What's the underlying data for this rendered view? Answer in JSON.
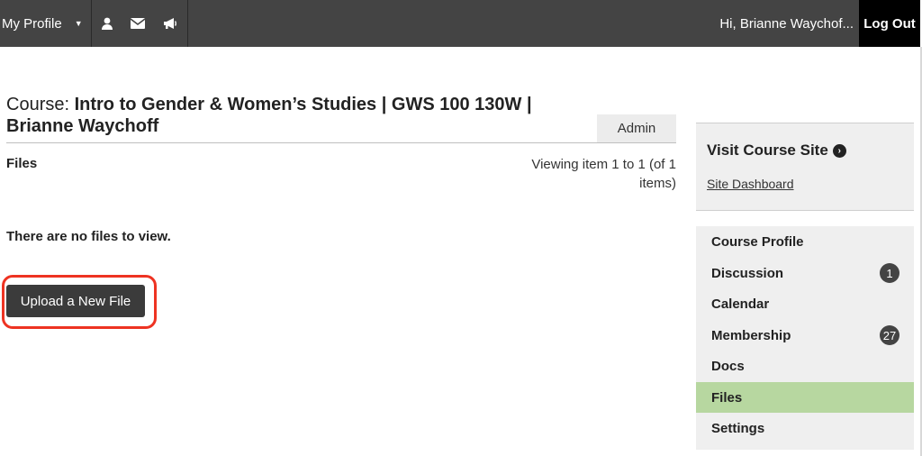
{
  "topbar": {
    "profile_label": "My Profile",
    "greeting": "Hi, Brianne Waychof...",
    "logout_label": "Log Out",
    "icons": [
      "user-icon",
      "envelope-icon",
      "megaphone-icon"
    ]
  },
  "course": {
    "prefix": "Course:",
    "name_line1": "Intro to Gender & Women’s Studies | GWS 100 130W |",
    "name_line2": "Brianne Waychoff",
    "admin_tab": "Admin"
  },
  "files": {
    "heading": "Files",
    "viewing": "Viewing item 1 to 1 (of 1 items)",
    "empty_message": "There are no files to view.",
    "upload_label": "Upload a New File"
  },
  "sidebar": {
    "visit_title": "Visit Course Site",
    "site_dashboard": "Site Dashboard",
    "nav": [
      {
        "label": "Course Profile",
        "badge": ""
      },
      {
        "label": "Discussion",
        "badge": "1"
      },
      {
        "label": "Calendar",
        "badge": ""
      },
      {
        "label": "Membership",
        "badge": "27"
      },
      {
        "label": "Docs",
        "badge": ""
      },
      {
        "label": "Files",
        "badge": ""
      },
      {
        "label": "Settings",
        "badge": ""
      }
    ]
  },
  "colors": {
    "topbar_bg": "#444444",
    "active_nav": "#b7d7a0",
    "highlight_ring": "#ee3322"
  }
}
